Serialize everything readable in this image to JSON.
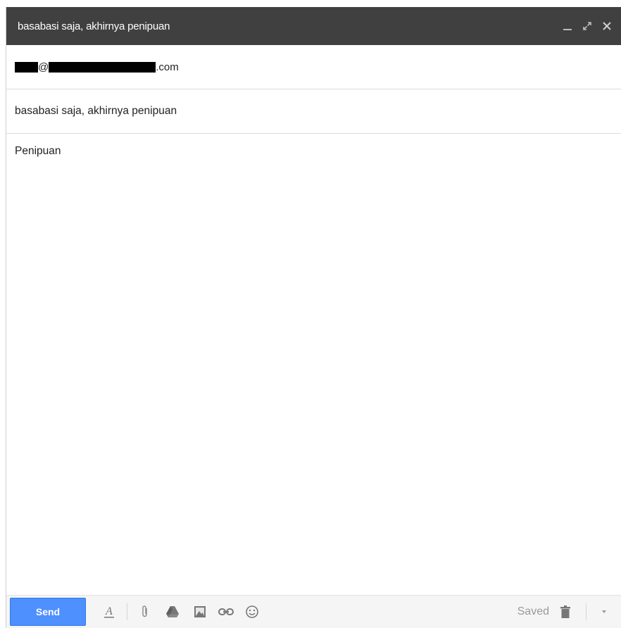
{
  "window": {
    "title": "basabasi saja, akhirnya penipuan",
    "controls": [
      "minimize-icon",
      "expand-icon",
      "close-icon"
    ]
  },
  "recipient": {
    "at": "@",
    "domain_suffix": ".com"
  },
  "subject": "basabasi saja, akhirnya penipuan",
  "message_body": "Penipuan",
  "toolbar": {
    "send_label": "Send",
    "icons": [
      "formatting-icon",
      "attach-icon",
      "drive-icon",
      "photo-icon",
      "link-icon",
      "emoji-icon"
    ],
    "status": "Saved",
    "discard_icon": "trash-icon",
    "more_icon": "chevron-down-icon"
  },
  "colors": {
    "titlebar": "#404040",
    "send_button": "#4d90fe",
    "toolbar_bg": "#f5f5f5"
  }
}
